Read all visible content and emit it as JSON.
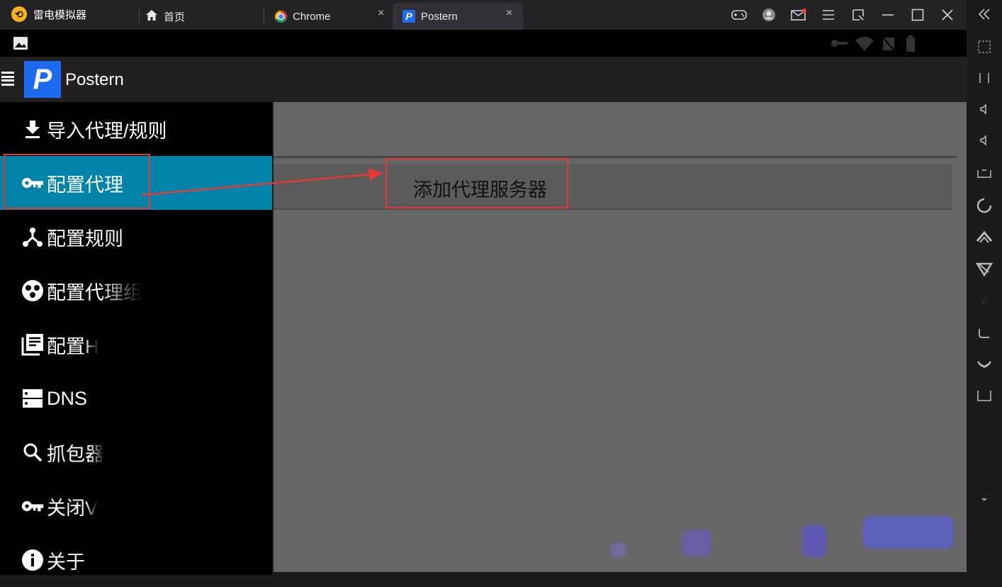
{
  "emulator": {
    "app_name": "雷电模拟器",
    "tabs": [
      {
        "label": "首页",
        "icon": "home-icon"
      },
      {
        "label": "Chrome",
        "icon": "chrome-icon"
      },
      {
        "label": "Postern",
        "icon": "postern-icon",
        "active": true
      }
    ],
    "close_glyph": "×"
  },
  "app": {
    "title": "Postern",
    "logo_letter": "P",
    "accent_color": "#0083a8",
    "brand_color": "#1e6bf0"
  },
  "drawer": {
    "items": [
      {
        "label": "导入代理/规则",
        "icon": "download-icon"
      },
      {
        "label": "配置代理",
        "icon": "key-icon",
        "active": true
      },
      {
        "label": "配置规则",
        "icon": "rules-branch-icon"
      },
      {
        "label": "配置代理组",
        "icon": "group-circles-icon"
      },
      {
        "label": "配置H",
        "icon": "library-icon"
      },
      {
        "label": "DNS",
        "icon": "server-icon"
      },
      {
        "label": "抓包器",
        "icon": "search-icon"
      },
      {
        "label": "关闭V",
        "icon": "key-icon"
      },
      {
        "label": "关于",
        "icon": "info-icon"
      }
    ]
  },
  "content": {
    "add_proxy_label": "添加代理服务器"
  },
  "annotation_color": "#e53935"
}
